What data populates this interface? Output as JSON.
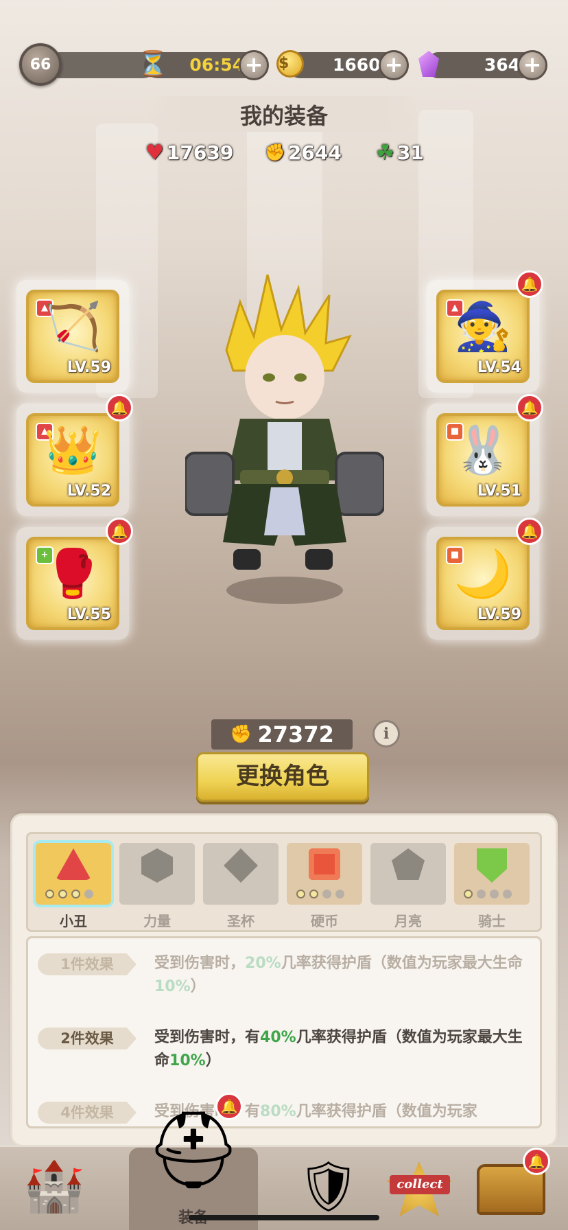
{
  "header": {
    "level": "66",
    "timer": "06:54",
    "coins": "16606",
    "gems": "364",
    "timer_icon": "hourglass-icon",
    "coin_icon": "gold-coin-icon",
    "gem_icon": "purple-gem-icon",
    "plus": "+"
  },
  "title": "我的装备",
  "stats": {
    "health": "17639",
    "attack": "2644",
    "luck": "31",
    "health_icon": "heart-icon",
    "attack_icon": "fist-icon",
    "luck_icon": "clover-icon"
  },
  "equipment": {
    "left": [
      {
        "level": "LV.59",
        "icon": "crossbow-icon",
        "rarity_icon": "clown-set-icon",
        "alert": false
      },
      {
        "level": "LV.52",
        "icon": "crown-icon",
        "rarity_icon": "clown-set-icon",
        "alert": true
      },
      {
        "level": "LV.55",
        "icon": "gauntlet-icon",
        "rarity_icon": "knight-set-icon",
        "alert": true
      }
    ],
    "right": [
      {
        "level": "LV.54",
        "icon": "wizard-hood-icon",
        "rarity_icon": "clown-set-icon",
        "alert": true
      },
      {
        "level": "LV.51",
        "icon": "bunny-slippers-icon",
        "rarity_icon": "coin-set-icon",
        "alert": true
      },
      {
        "level": "LV.59",
        "icon": "moon-earring-icon",
        "rarity_icon": "coin-set-icon",
        "alert": true
      }
    ]
  },
  "power": "27372",
  "info": "i",
  "change_button": "更换角色",
  "sets": [
    {
      "label": "小丑",
      "icon": "clown-set-icon",
      "state": "active",
      "dots": [
        "on",
        "on",
        "on",
        "off"
      ]
    },
    {
      "label": "力量",
      "icon": "strength-set-icon",
      "state": "locked",
      "dots": []
    },
    {
      "label": "圣杯",
      "icon": "grail-set-icon",
      "state": "locked",
      "dots": []
    },
    {
      "label": "硬币",
      "icon": "coin-set-icon",
      "state": "owned",
      "dots": [
        "on",
        "on",
        "off",
        "off"
      ]
    },
    {
      "label": "月亮",
      "icon": "moon-set-icon",
      "state": "locked",
      "dots": []
    },
    {
      "label": "骑士",
      "icon": "knight-set-icon",
      "state": "owned",
      "dots": [
        "on",
        "off",
        "off",
        "off"
      ]
    }
  ],
  "effects": [
    {
      "tag": "1件效果",
      "pre": "受到伤害时，",
      "v1": "20%",
      "mid": "几率获得护盾（数值为玩家最大生命",
      "v2": "10%",
      "post": "）",
      "state": "dim"
    },
    {
      "tag": "2件效果",
      "pre": "受到伤害时，有",
      "v1": "40%",
      "mid": "几率获得护盾（数值为玩家最大生命",
      "v2": "10%",
      "post": "）",
      "state": "on"
    },
    {
      "tag": "4件效果",
      "pre": "受到伤害时，有",
      "v1": "80%",
      "mid": "几率获得护盾（数值为玩家",
      "v2": "",
      "post": "",
      "state": "dim"
    }
  ],
  "nav": {
    "equip_label": "装备",
    "items": [
      "castle-icon",
      "helmet-icon",
      "sword-shield-icon",
      "collect-badge-icon",
      "treasure-chest-icon"
    ],
    "collect_text": "collect"
  },
  "colors": {
    "accent_gold": "#efd354",
    "alert_red": "#d9363e",
    "effect_green": "#3fa54b"
  }
}
